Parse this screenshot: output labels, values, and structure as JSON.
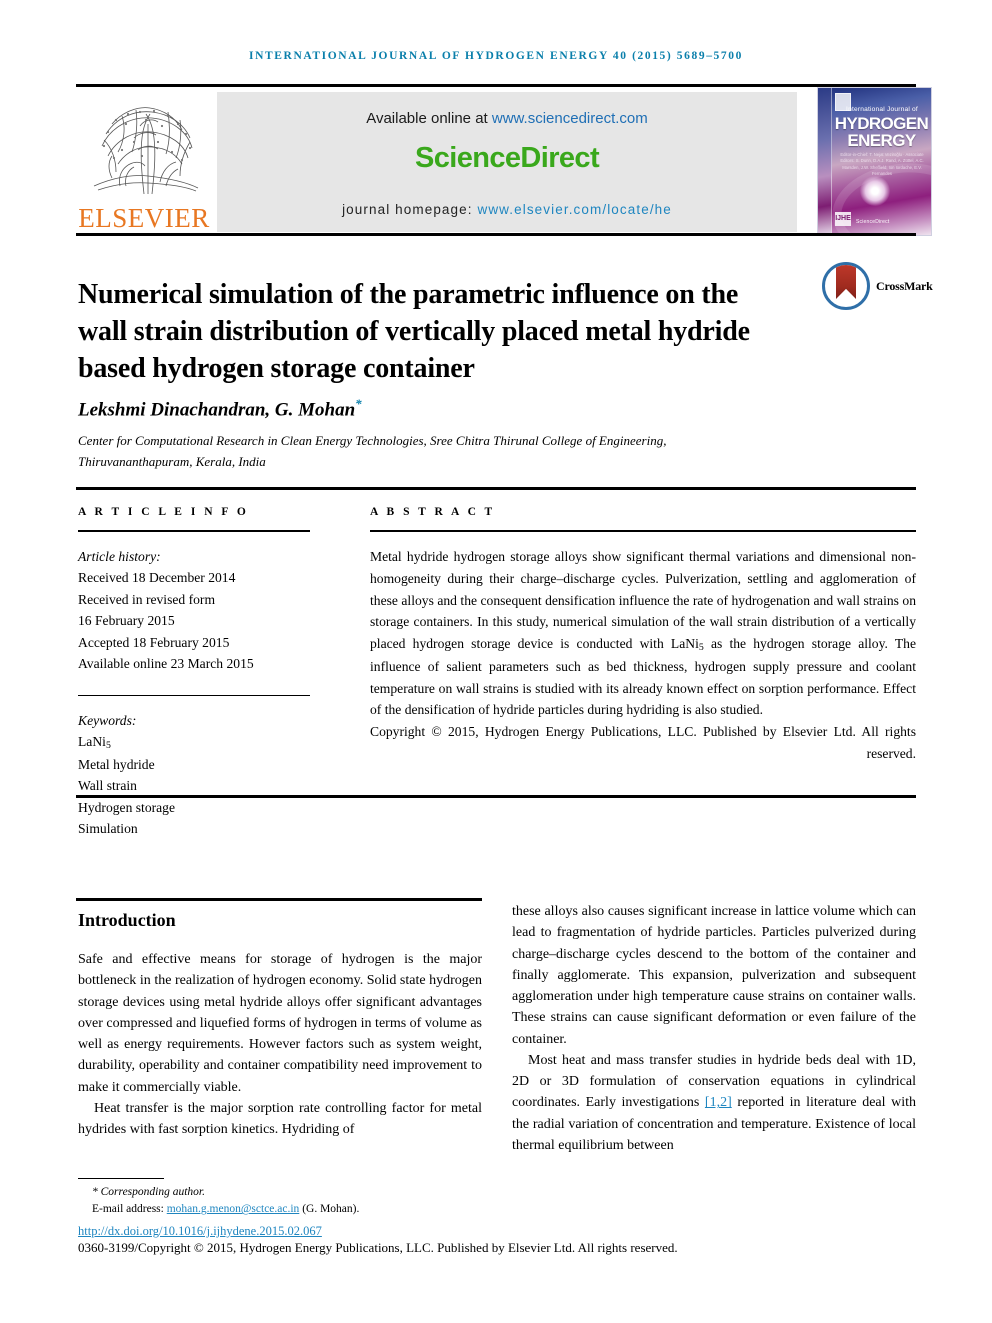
{
  "running_head": "International Journal of Hydrogen Energy 40 (2015) 5689–5700",
  "masthead": {
    "available_prefix": "Available online at ",
    "available_link": "www.sciencedirect.com",
    "sciencedirect_logo": "ScienceDirect",
    "homepage_prefix": "journal homepage: ",
    "homepage_link": "www.elsevier.com/locate/he",
    "publisher": "ELSEVIER",
    "cover": {
      "line1": "International Journal of",
      "line2": "HYDROGEN",
      "line3": "ENERGY",
      "editors": "Editor-in-Chief: T. Nejat Veziroğlu · Associate Editors: S. Dunn, D.A.J. Rand, A. Züttel, A.C. Marsden, J.W. Sheffield, Ion Iordache, E.V. Fernandes",
      "badge": "IJHE",
      "sciencedirect_mark": "ScienceDirect"
    }
  },
  "article": {
    "title": "Numerical simulation of the parametric influence on the wall strain distribution of vertically placed metal hydride based hydrogen storage container",
    "crossmark_label": "CrossMark",
    "authors": "Lekshmi Dinachandran, G. Mohan",
    "corresponding_marker": "*",
    "affiliation": "Center for Computational Research in Clean Energy Technologies, Sree Chitra Thirunal College of Engineering, Thiruvananthapuram, Kerala, India"
  },
  "article_info": {
    "heading": "A R T I C L E  I N F O",
    "history_label": "Article history:",
    "history": [
      "Received 18 December 2014",
      "Received in revised form",
      "16 February 2015",
      "Accepted 18 February 2015",
      "Available online 23 March 2015"
    ],
    "keywords_label": "Keywords:",
    "keywords": [
      "LaNi5",
      "Metal hydride",
      "Wall strain",
      "Hydrogen storage",
      "Simulation"
    ]
  },
  "abstract": {
    "heading": "A B S T R A C T",
    "text": "Metal hydride hydrogen storage alloys show significant thermal variations and dimensional non-homogeneity during their charge–discharge cycles. Pulverization, settling and agglomeration of these alloys and the consequent densification influence the rate of hydrogenation and wall strains on storage containers. In this study, numerical simulation of the wall strain distribution of a vertically placed hydrogen storage device is conducted with LaNi5 as the hydrogen storage alloy. The influence of salient parameters such as bed thickness, hydrogen supply pressure and coolant temperature on wall strains is studied with its already known effect on sorption performance. Effect of the densification of hydride particles during hydriding is also studied.",
    "copyright": "Copyright © 2015, Hydrogen Energy Publications, LLC. Published by Elsevier Ltd. All rights reserved."
  },
  "introduction": {
    "heading": "Introduction",
    "left_paragraphs": [
      "Safe and effective means for storage of hydrogen is the major bottleneck in the realization of hydrogen economy. Solid state hydrogen storage devices using metal hydride alloys offer significant advantages over compressed and liquefied forms of hydrogen in terms of volume as well as energy requirements. However factors such as system weight, durability, operability and container compatibility need improvement to make it commercially viable.",
      "Heat transfer is the major sorption rate controlling factor for metal hydrides with fast sorption kinetics. Hydriding of"
    ],
    "right_paragraph_1": "these alloys also causes significant increase in lattice volume which can lead to fragmentation of hydride particles. Particles pulverized during charge–discharge cycles descend to the bottom of the container and finally agglomerate. This expansion, pulverization and subsequent agglomeration under high temperature cause strains on container walls. These strains can cause significant deformation or even failure of the container.",
    "right_paragraph_2_a": "Most heat and mass transfer studies in hydride beds deal with 1D, 2D or 3D formulation of conservation equations in cylindrical coordinates. Early investigations ",
    "right_citation": "[1,2]",
    "right_paragraph_2_b": " reported in literature deal with the radial variation of concentration and temperature. Existence of local thermal equilibrium between"
  },
  "footer": {
    "corresponding": "* Corresponding author.",
    "email_label": "E-mail address: ",
    "email": "mohan.g.menon@sctce.ac.in",
    "email_suffix": " (G. Mohan).",
    "doi": "http://dx.doi.org/10.1016/j.ijhydene.2015.02.067",
    "issn_copyright": "0360-3199/Copyright © 2015, Hydrogen Energy Publications, LLC. Published by Elsevier Ltd. All rights reserved."
  },
  "colors": {
    "journal_blue": "#0a7fab",
    "link_blue": "#1f86c0",
    "sciencedirect_green": "#3aa81c",
    "elsevier_orange": "#e87722"
  }
}
